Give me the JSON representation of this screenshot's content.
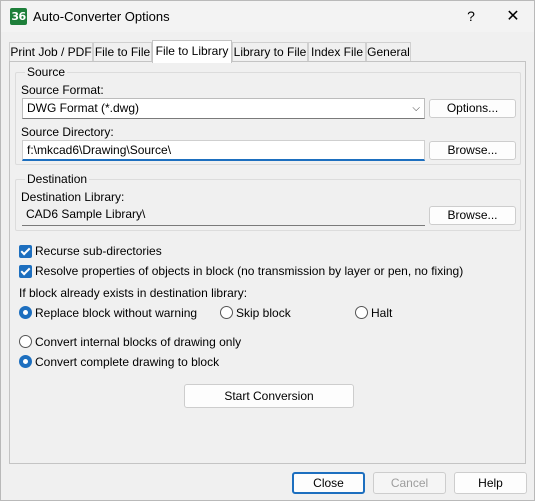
{
  "window": {
    "title": "Auto-Converter Options",
    "icon_text": "36",
    "help_glyph": "?",
    "close_glyph": "✕"
  },
  "tabs": [
    {
      "label": "Print Job / PDF"
    },
    {
      "label": "File to File"
    },
    {
      "label": "File to Library",
      "active": true
    },
    {
      "label": "Library to File"
    },
    {
      "label": "Index File"
    },
    {
      "label": "General"
    }
  ],
  "source": {
    "group_title": "Source",
    "format_label": "Source Format:",
    "format_value": "DWG Format (*.dwg)",
    "options_button": "Options...",
    "directory_label": "Source Directory:",
    "directory_value": "f:\\mkcad6\\Drawing\\Source\\",
    "browse_button": "Browse..."
  },
  "destination": {
    "group_title": "Destination",
    "library_label": "Destination Library:",
    "library_value": "CAD6 Sample Library\\",
    "browse_button": "Browse..."
  },
  "checks": {
    "recurse": "Recurse sub-directories",
    "resolve": "Resolve properties of objects in block (no transmission by layer or pen, no fixing)"
  },
  "exists": {
    "prompt": "If block already exists in destination library:",
    "replace": "Replace block without warning",
    "skip": "Skip block",
    "halt": "Halt"
  },
  "convert": {
    "internal": "Convert internal blocks of drawing only",
    "complete": "Convert complete drawing to block",
    "start_button": "Start Conversion"
  },
  "footer": {
    "close": "Close",
    "cancel": "Cancel",
    "help": "Help"
  },
  "colors": {
    "accent": "#1d6fbf",
    "icon_bg": "#1e7f3a"
  }
}
